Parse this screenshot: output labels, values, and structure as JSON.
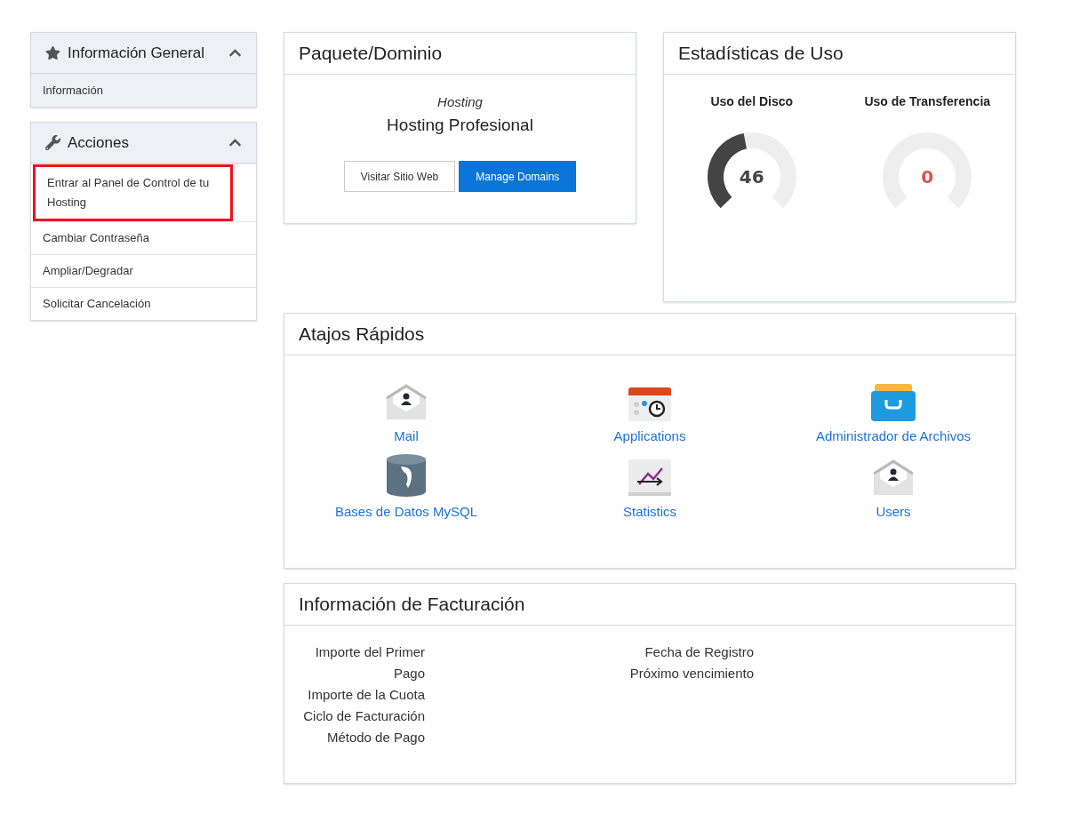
{
  "sidebar": [
    {
      "title": "Información General",
      "kind": "star",
      "expanded": true,
      "items": [
        {
          "label": "Información",
          "highlighted": false
        }
      ]
    },
    {
      "title": "Acciones",
      "kind": "wrench",
      "expanded": true,
      "items": [
        {
          "label": "Entrar al Panel de Control de tu Hosting",
          "highlighted": true
        },
        {
          "label": "Cambiar Contraseña",
          "highlighted": false
        },
        {
          "label": "Ampliar/Degradar",
          "highlighted": false
        },
        {
          "label": "Solicitar Cancelación",
          "highlighted": false
        }
      ]
    }
  ],
  "package": {
    "title": "Paquete/Dominio",
    "group": "Hosting",
    "product": "Hosting Profesional",
    "buttons": [
      {
        "label": "Visitar Sitio Web",
        "kind": "secondary"
      },
      {
        "label": "Manage Domains",
        "kind": "primary"
      }
    ]
  },
  "usage": {
    "title": "Estadísticas de Uso",
    "gauges": [
      {
        "label": "Uso del Disco",
        "value": "46",
        "level": 0.46,
        "color": "#444444"
      },
      {
        "label": "Uso de Transferencia",
        "value": "0",
        "color": "#d9534f"
      }
    ]
  },
  "shortcuts": {
    "title": "Atajos Rápidos",
    "items": [
      {
        "label": "Mail",
        "kind": "envelope"
      },
      {
        "label": "Applications",
        "kind": "calendar"
      },
      {
        "label": "Administrador de Archivos",
        "kind": "filebox"
      },
      {
        "label": "Bases de Datos MySQL",
        "kind": "database"
      },
      {
        "label": "Statistics",
        "kind": "chart"
      },
      {
        "label": "Users",
        "kind": "envelope"
      }
    ]
  },
  "billing": {
    "title": "Información de Facturación",
    "left": [
      "Importe del Primer Pago",
      "Importe de la Cuota",
      "Ciclo de Facturación",
      "Método de Pago"
    ],
    "right": [
      "Fecha de Registro",
      "Próximo vencimiento"
    ]
  }
}
